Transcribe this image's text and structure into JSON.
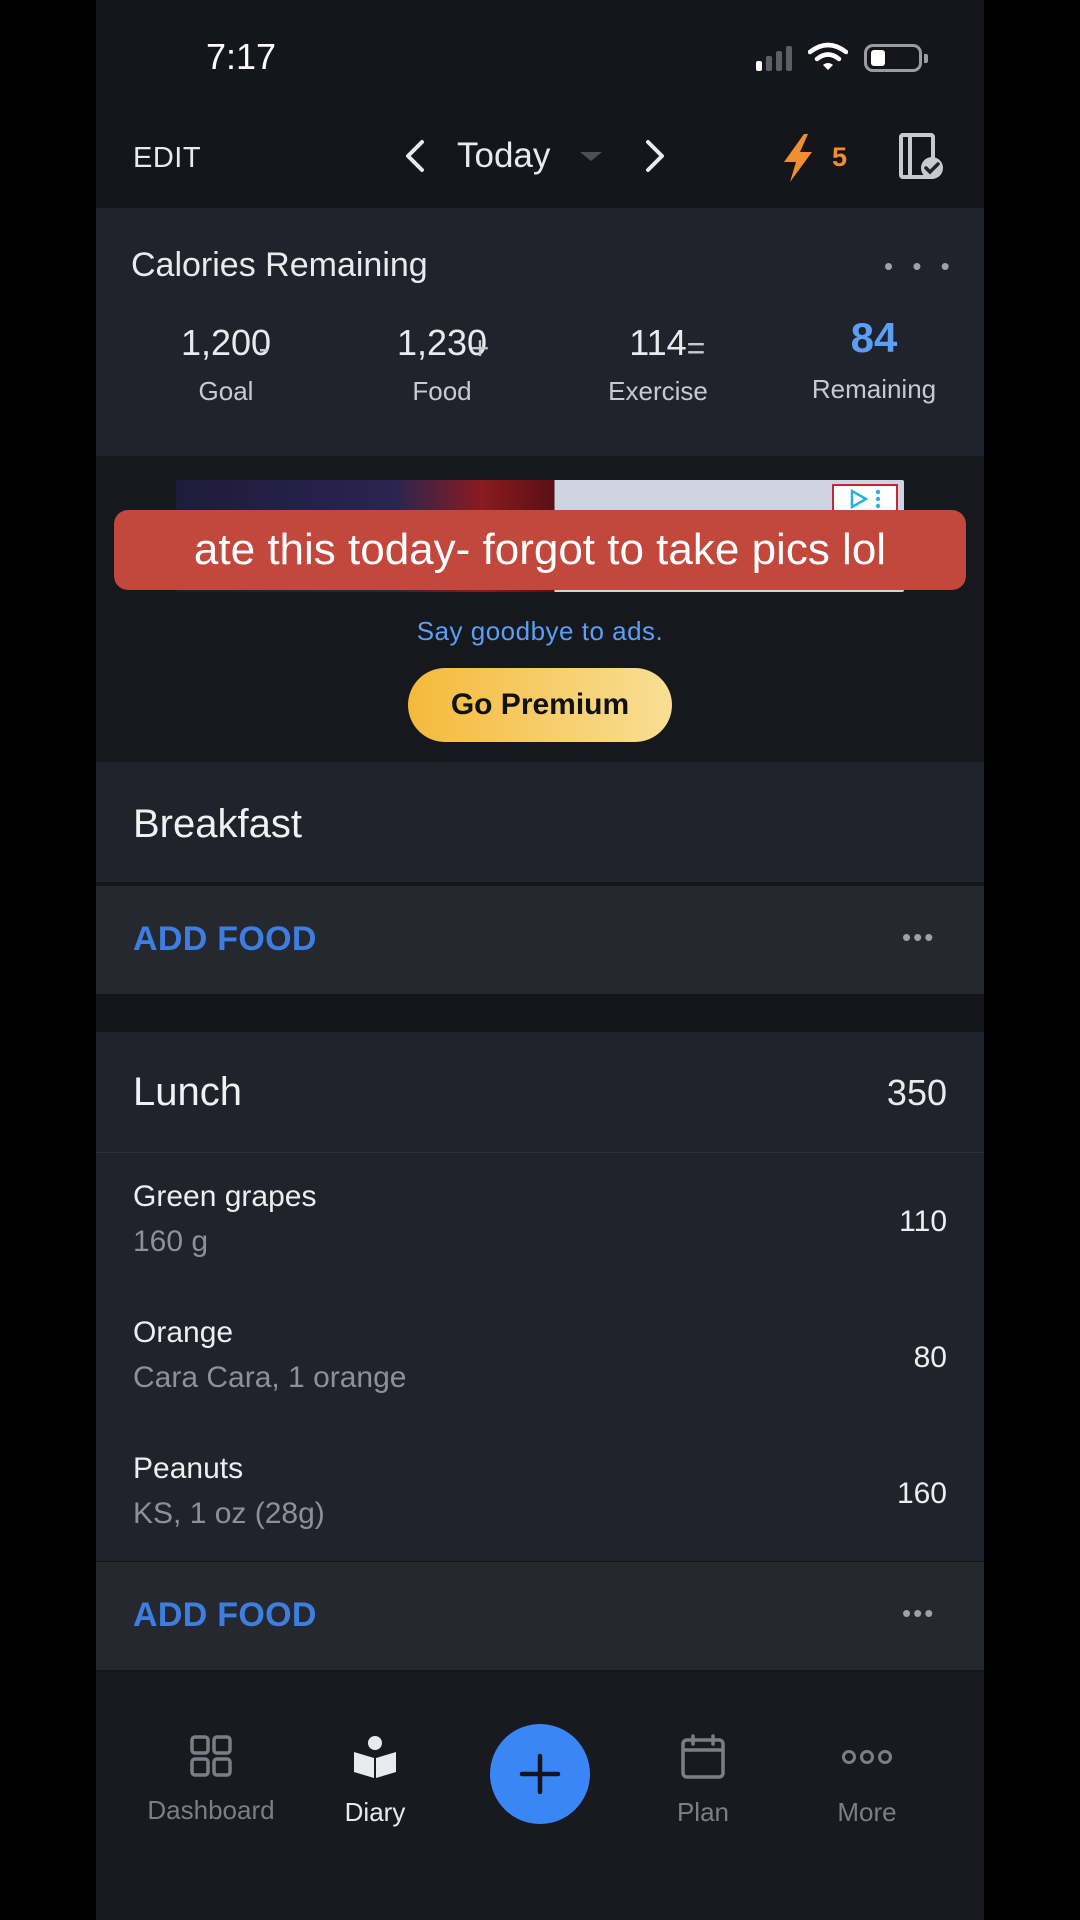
{
  "status": {
    "time": "7:17"
  },
  "header": {
    "edit": "EDIT",
    "date": "Today",
    "streak": "5"
  },
  "calories": {
    "title": "Calories Remaining",
    "more": "• • •",
    "goal": {
      "value": "1,200",
      "label": "Goal"
    },
    "op1": "-",
    "food": {
      "value": "1,230",
      "label": "Food"
    },
    "op2": "+",
    "exercise": {
      "value": "114",
      "label": "Exercise"
    },
    "op3": "=",
    "remaining": {
      "value": "84",
      "label": "Remaining"
    }
  },
  "ad": {
    "caption": "ate this today- forgot to take pics lol",
    "goodbye": "Say goodbye to ads.",
    "premium": "Go Premium"
  },
  "breakfast": {
    "title": "Breakfast",
    "add_food": "ADD FOOD",
    "more": "•••"
  },
  "lunch": {
    "title": "Lunch",
    "calories": "350",
    "items": [
      {
        "name": "Green grapes",
        "desc": "160 g",
        "cal": "110"
      },
      {
        "name": "Orange",
        "desc": "Cara Cara, 1 orange",
        "cal": "80"
      },
      {
        "name": "Peanuts",
        "desc": "KS, 1 oz (28g)",
        "cal": "160"
      }
    ],
    "add_food": "ADD FOOD",
    "more": "•••"
  },
  "tabs": {
    "dashboard": "Dashboard",
    "diary": "Diary",
    "plan": "Plan",
    "more": "More",
    "active": "Diary"
  },
  "colors": {
    "accent": "#3a86f5",
    "remaining": "#5a9ef5",
    "streak": "#f28e32",
    "caption_bg": "#c2473c"
  }
}
